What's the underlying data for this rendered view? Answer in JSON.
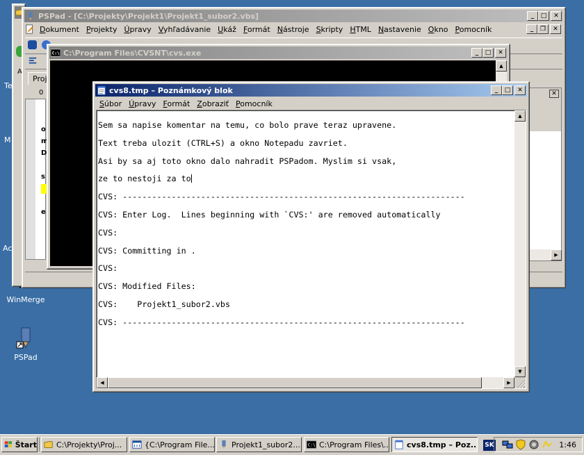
{
  "desktop": {
    "icons": [
      {
        "label": "WinMerge"
      },
      {
        "label": "PSPad"
      }
    ],
    "partial_labels": [
      "Te",
      "M",
      "Ac"
    ]
  },
  "pspad": {
    "title": "PSPad - [C:\\Projekty\\Projekt1\\Projekt1_subor2.vbs]",
    "menu": [
      "Dokument",
      "Projekty",
      "Úpravy",
      "Vyhľadávanie",
      "Ukáž",
      "Formát",
      "Nástroje",
      "Skripty",
      "HTML",
      "Nastavenie",
      "Okno",
      "Pomocník"
    ],
    "tab_partial": "Proje",
    "ruler_label": "0",
    "gutter_letters": [
      "o",
      "m",
      "D",
      "s",
      "e"
    ]
  },
  "cvs_console": {
    "title": "C:\\Program Files\\CVSNT\\cvs.exe"
  },
  "notepad": {
    "title": "cvs8.tmp – Poznámkový blok",
    "menu": [
      "Súbor",
      "Úpravy",
      "Formát",
      "Zobraziť",
      "Pomocník"
    ],
    "lines": [
      "Sem sa napise komentar na temu, co bolo prave teraz upravene.",
      "Text treba ulozit (CTRL+S) a okno Notepadu zavriet.",
      "Asi by sa aj toto okno dalo nahradit PSPadom. Myslim si vsak,",
      "ze to nestoji za to",
      "CVS: ----------------------------------------------------------------------",
      "CVS: Enter Log.  Lines beginning with `CVS:' are removed automatically",
      "CVS:",
      "CVS: Committing in .",
      "CVS:",
      "CVS: Modified Files:",
      "CVS:    Projekt1_subor2.vbs",
      "CVS: ----------------------------------------------------------------------"
    ]
  },
  "taskbar": {
    "start_label": "Štart",
    "buttons": [
      {
        "label": "C:\\Projekty\\Proj..."
      },
      {
        "label": "{C:\\Program File..."
      },
      {
        "label": "Projekt1_subor2...."
      },
      {
        "label": "C:\\Program Files\\..."
      },
      {
        "label": "cvs8.tmp – Poz..."
      }
    ],
    "language": "SK",
    "clock": "1:46"
  },
  "colors": {
    "desktop": "#3a6ea5",
    "active_title": "#0a246a",
    "inactive_title": "#808080",
    "window_face": "#d4d0c8"
  }
}
